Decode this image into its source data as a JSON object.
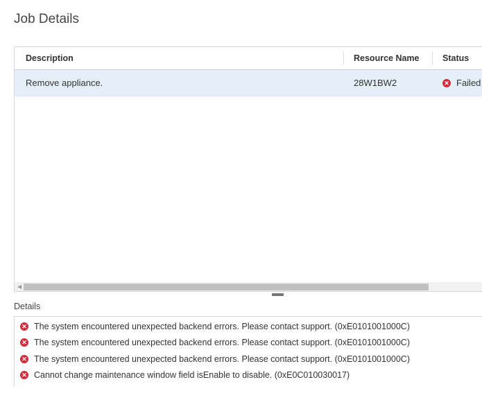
{
  "title": "Job Details",
  "table": {
    "headers": [
      "Description",
      "Resource Name",
      "Status"
    ],
    "rows": [
      {
        "description": "Remove appliance.",
        "resource": "28W1BW2",
        "status": "Failed"
      }
    ]
  },
  "details": {
    "label": "Details",
    "items": [
      "The system encountered unexpected backend errors. Please contact support. (0xE0101001000C)",
      "The system encountered unexpected backend errors. Please contact support. (0xE0101001000C)",
      "The system encountered unexpected backend errors. Please contact support. (0xE0101001000C)",
      "Cannot change maintenance window field isEnable to disable. (0xE0C010030017)"
    ]
  },
  "colors": {
    "error": "#d22b3a",
    "row_selected": "#e4eff9"
  }
}
